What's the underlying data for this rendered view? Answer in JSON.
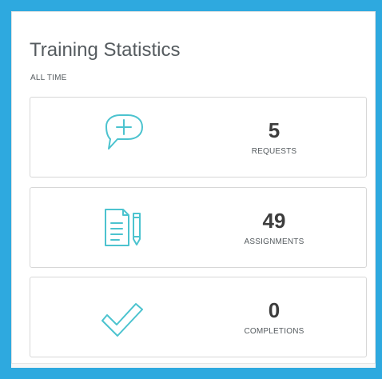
{
  "widget": {
    "title": "Training Statistics",
    "subtitle": "ALL TIME"
  },
  "stats": [
    {
      "icon": "speech-bubble-plus-icon",
      "value": "5",
      "label": "REQUESTS"
    },
    {
      "icon": "document-pencil-icon",
      "value": "49",
      "label": "ASSIGNMENTS"
    },
    {
      "icon": "checkmark-icon",
      "value": "0",
      "label": "COMPLETIONS"
    }
  ],
  "colors": {
    "frame": "#2ea9df",
    "accent": "#4cc3cf",
    "text": "#555b5f",
    "value": "#3d3d3d",
    "border": "#d7d7d7"
  }
}
